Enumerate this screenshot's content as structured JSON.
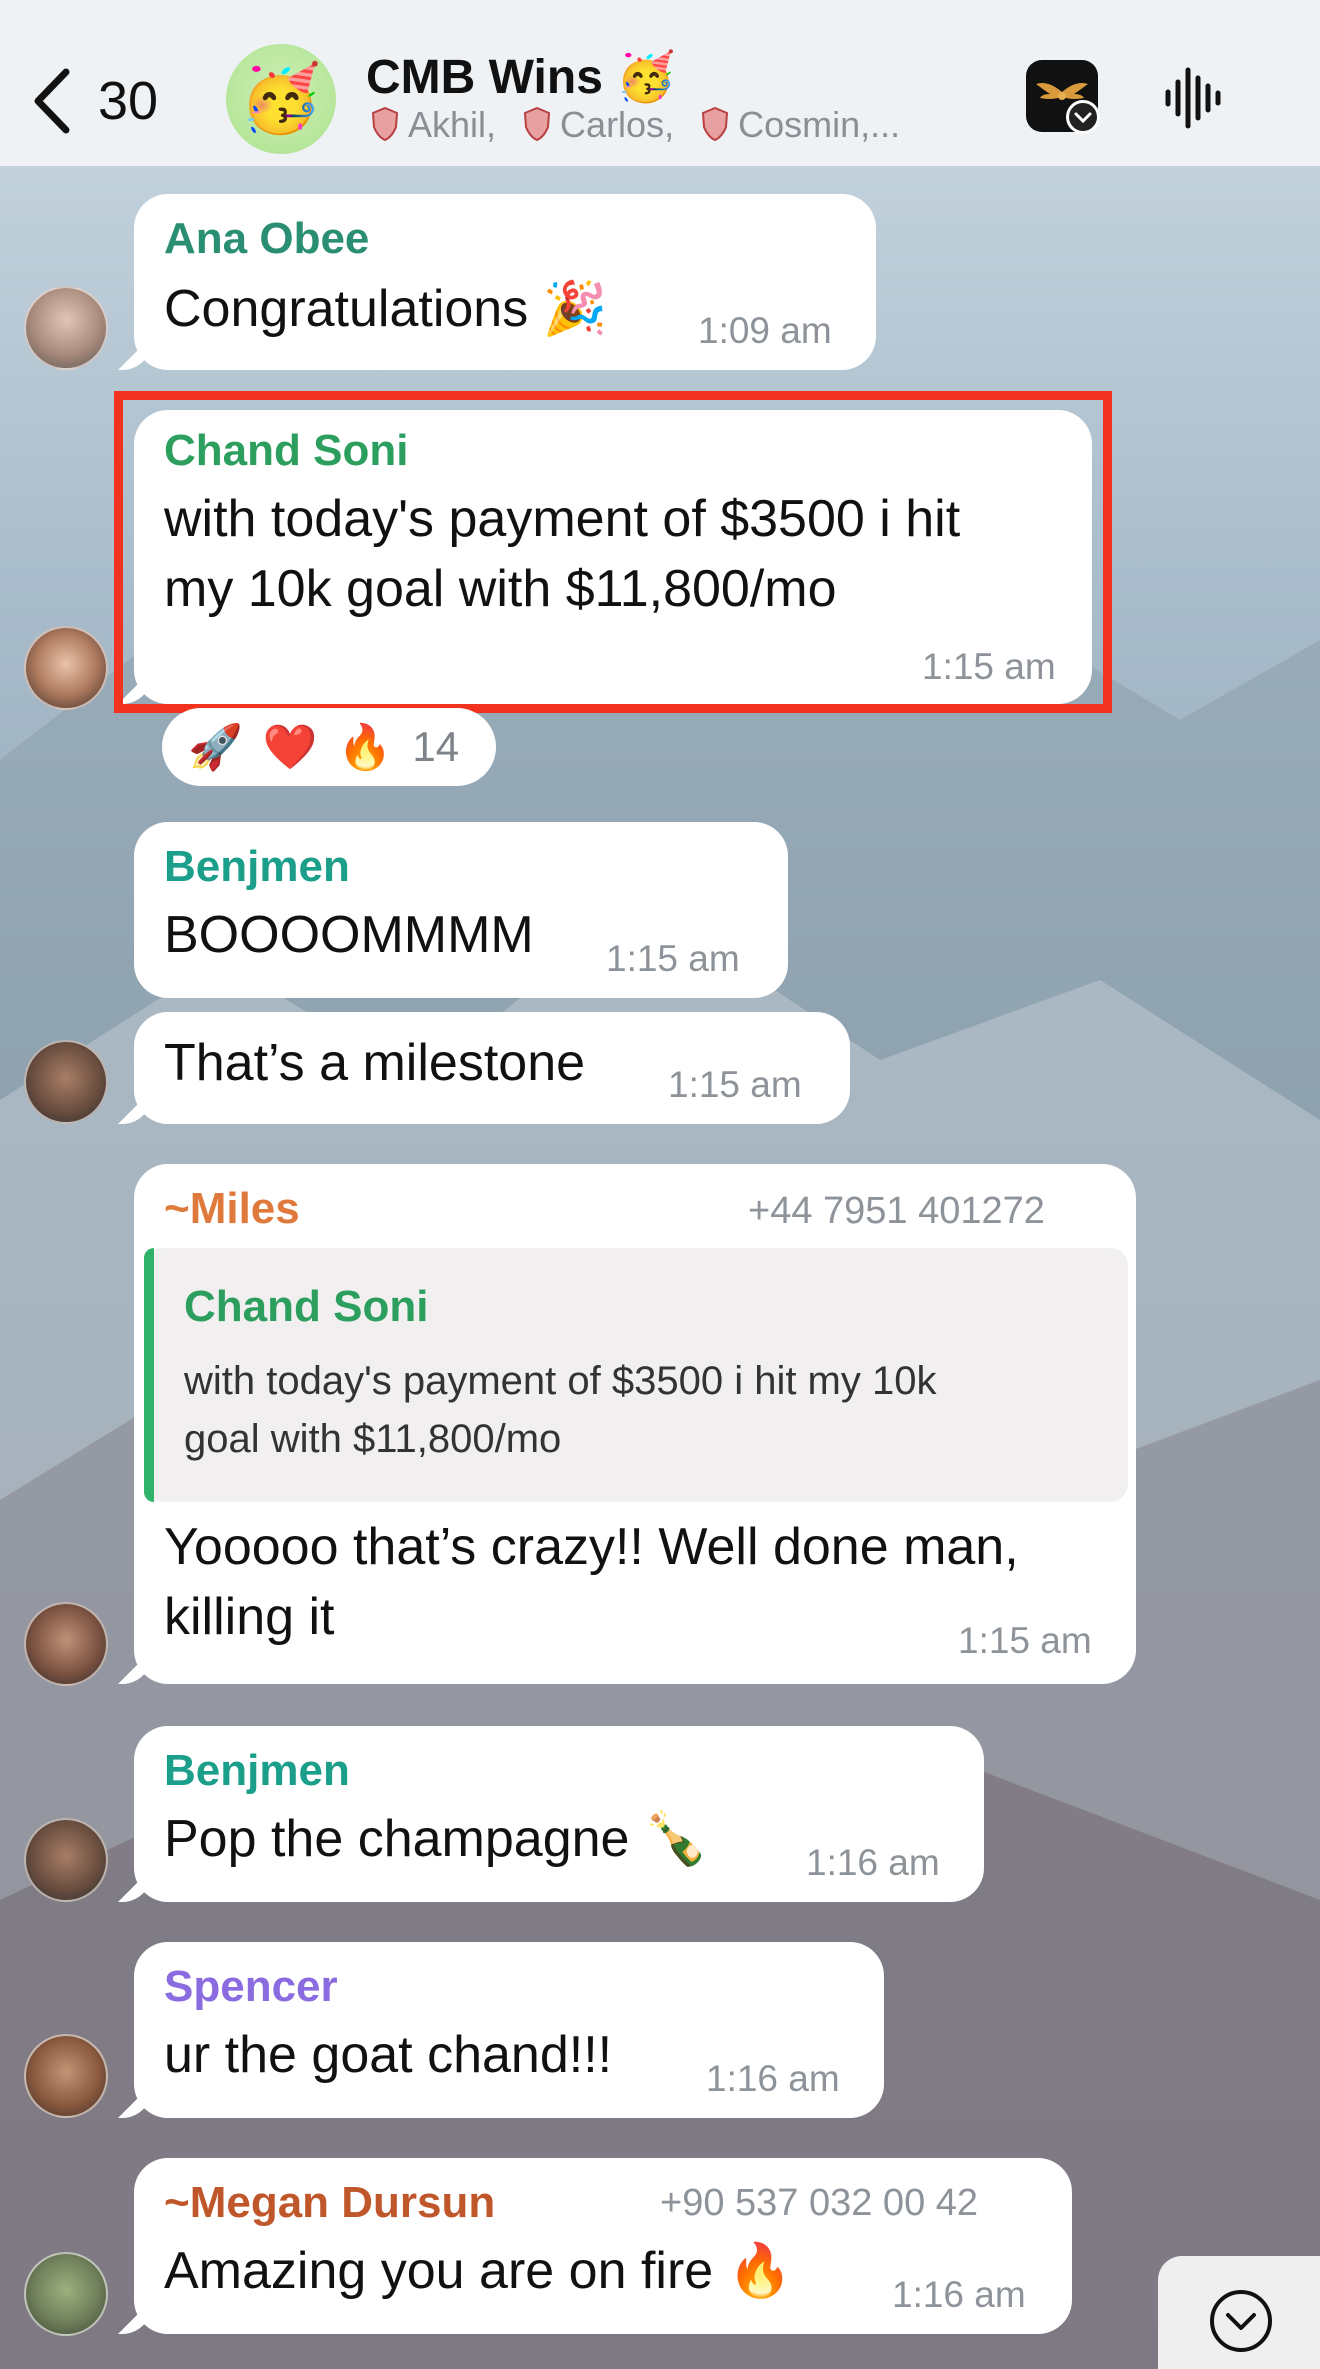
{
  "header": {
    "back_count": "30",
    "title": "CMB Wins 🥳",
    "avatar_emoji": "🥳",
    "members": [
      "Akhil,",
      "Carlos,",
      "Cosmin,..."
    ]
  },
  "messages": [
    {
      "sender": "Ana Obee",
      "sender_color": "#2a8f72",
      "text": "Congratulations 🎉",
      "time": "1:09 am"
    },
    {
      "sender": "Chand Soni",
      "sender_color": "#2c9e5d",
      "lines": [
        "with today's payment of $3500 i hit",
        "my 10k goal with $11,800/mo"
      ],
      "time": "1:15 am",
      "reactions": {
        "emojis": [
          "🚀",
          "❤️",
          "🔥"
        ],
        "count": "14"
      }
    },
    {
      "sender": "Benjmen",
      "sender_color": "#1b9e8a",
      "text": "BOOOOMMMM",
      "time": "1:15 am"
    },
    {
      "text": "That’s a milestone",
      "time": "1:15 am"
    },
    {
      "sender": "~Miles",
      "sender_color": "#e07a3c",
      "phone": "+44 7951 401272",
      "quote": {
        "name": "Chand Soni",
        "lines": [
          "with today's payment of $3500 i hit my 10k",
          "goal with $11,800/mo"
        ]
      },
      "lines": [
        "Yooooo that’s crazy!! Well done man,",
        "killing it"
      ],
      "time": "1:15 am"
    },
    {
      "sender": "Benjmen",
      "sender_color": "#1b9e8a",
      "text": "Pop the champagne 🍾",
      "time": "1:16 am"
    },
    {
      "sender": "Spencer",
      "sender_color": "#8a6be0",
      "text": "ur the goat chand!!!",
      "time": "1:16 am"
    },
    {
      "sender": "~Megan Dursun",
      "sender_color": "#c0572b",
      "phone": "+90 537 032 00 42",
      "text": "Amazing you are on fire 🔥",
      "time": "1:16 am"
    }
  ],
  "colors": {
    "highlight": "#f0321e",
    "bubble": "#ffffff"
  }
}
